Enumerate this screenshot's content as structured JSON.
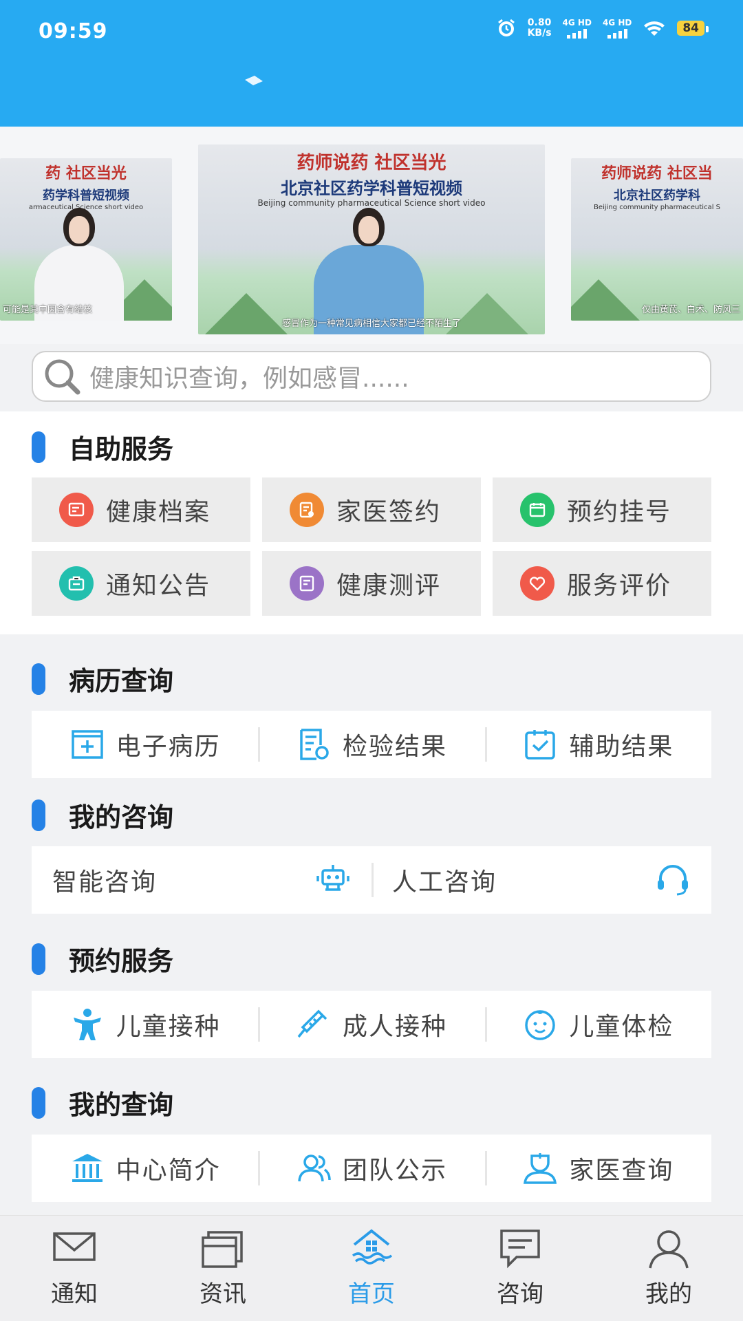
{
  "status_bar": {
    "time": "09:59",
    "net_speed": "0.80",
    "net_unit": "KB/s",
    "sim1": "4G HD",
    "sim2": "4G HD",
    "battery": "84"
  },
  "banner": {
    "slides": [
      {
        "title": "药  社区当光",
        "subtitle": "药学科普短视频",
        "english": "armaceutical Science short video",
        "caption": "可能是其中因含有结核"
      },
      {
        "title": "药师说药  社区当光",
        "subtitle": "北京社区药学科普短视频",
        "english": "Beijing community pharmaceutical Science short video",
        "caption": "感冒作为一种常见病相信大家都已经不陌生了"
      },
      {
        "title": "药师说药  社区当",
        "subtitle": "北京社区药学科",
        "english": "Beijing community pharmaceutical S",
        "caption": "仅由黄芪、白术、防风三"
      }
    ]
  },
  "search": {
    "placeholder": "健康知识查询，例如感冒......"
  },
  "self_service": {
    "title": "自助服务",
    "items": [
      {
        "label": "健康档案",
        "color": "#f05a4a",
        "icon": "health-record-icon"
      },
      {
        "label": "家医签约",
        "color": "#f08a34",
        "icon": "family-doctor-sign-icon"
      },
      {
        "label": "预约挂号",
        "color": "#27c26c",
        "icon": "appointment-register-icon"
      },
      {
        "label": "通知公告",
        "color": "#22bfae",
        "icon": "notice-icon"
      },
      {
        "label": "健康测评",
        "color": "#9b73c7",
        "icon": "health-assessment-icon"
      },
      {
        "label": "服务评价",
        "color": "#f05a4a",
        "icon": "service-rating-icon"
      }
    ]
  },
  "records": {
    "title": "病历查询",
    "items": [
      {
        "label": "电子病历",
        "icon": "medical-record-icon"
      },
      {
        "label": "检验结果",
        "icon": "lab-result-icon"
      },
      {
        "label": "辅助结果",
        "icon": "auxiliary-result-icon"
      }
    ]
  },
  "consult": {
    "title": "我的咨询",
    "items": [
      {
        "label": "智能咨询",
        "icon": "robot-icon"
      },
      {
        "label": "人工咨询",
        "icon": "headset-icon"
      }
    ]
  },
  "appointments": {
    "title": "预约服务",
    "items": [
      {
        "label": "儿童接种",
        "icon": "child-icon"
      },
      {
        "label": "成人接种",
        "icon": "syringe-icon"
      },
      {
        "label": "儿童体检",
        "icon": "baby-face-icon"
      }
    ]
  },
  "queries": {
    "title": "我的查询",
    "items": [
      {
        "label": "中心简介",
        "icon": "building-icon"
      },
      {
        "label": "团队公示",
        "icon": "team-icon"
      },
      {
        "label": "家医查询",
        "icon": "doctor-icon"
      }
    ]
  },
  "tabbar": {
    "active": "首页",
    "items": [
      {
        "label": "通知",
        "icon": "mail-icon"
      },
      {
        "label": "资讯",
        "icon": "news-icon"
      },
      {
        "label": "首页",
        "icon": "home-icon"
      },
      {
        "label": "咨询",
        "icon": "chat-icon"
      },
      {
        "label": "我的",
        "icon": "user-icon"
      }
    ]
  },
  "colors": {
    "header": "#27aaf2",
    "accent": "#2582e6",
    "icon_blue": "#2aa8e8"
  }
}
